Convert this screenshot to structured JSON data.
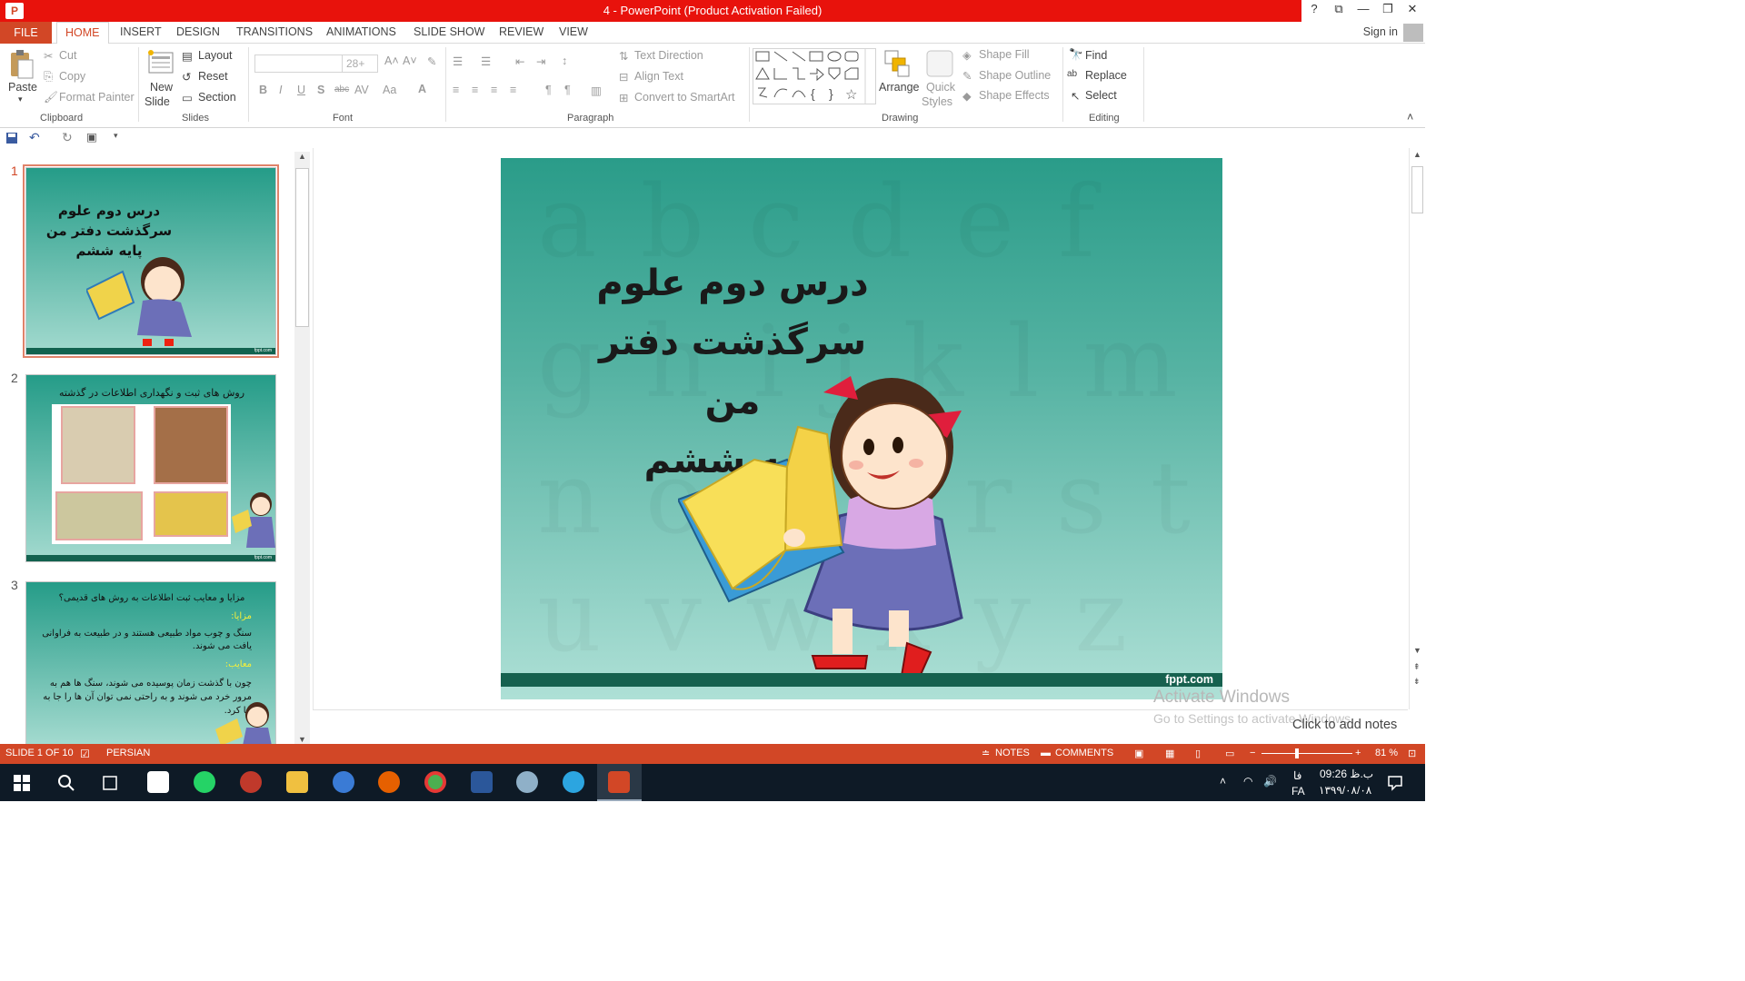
{
  "window": {
    "title": "4 -  PowerPoint (Product Activation Failed)",
    "app_icon": "P",
    "controls": [
      "?",
      "⧉",
      "—",
      "❐",
      "✕"
    ]
  },
  "tabs": {
    "file": "FILE",
    "items": [
      "HOME",
      "INSERT",
      "DESIGN",
      "TRANSITIONS",
      "ANIMATIONS",
      "SLIDE SHOW",
      "REVIEW",
      "VIEW"
    ],
    "sign_in": "Sign in"
  },
  "ribbon": {
    "clipboard": {
      "paste": "Paste",
      "cut": "Cut",
      "copy": "Copy",
      "format_painter": "Format Painter",
      "label": "Clipboard"
    },
    "slides": {
      "new_slide_1": "New",
      "new_slide_2": "Slide",
      "layout": "Layout",
      "reset": "Reset",
      "section": "Section",
      "label": "Slides"
    },
    "font": {
      "size": "28+",
      "label": "Font"
    },
    "paragraph": {
      "text_direction": "Text Direction",
      "align_text": "Align Text",
      "convert_smartart": "Convert to SmartArt",
      "label": "Paragraph"
    },
    "drawing": {
      "arrange": "Arrange",
      "quick_styles_1": "Quick",
      "quick_styles_2": "Styles",
      "shape_fill": "Shape Fill",
      "shape_outline": "Shape Outline",
      "shape_effects": "Shape Effects",
      "label": "Drawing"
    },
    "editing": {
      "find": "Find",
      "replace": "Replace",
      "select": "Select",
      "label": "Editing"
    }
  },
  "thumbnails": [
    {
      "num": "1",
      "title": "درس دوم علوم\nسرگذشت دفتر من\nپایه ششم",
      "brand": "fppt.com"
    },
    {
      "num": "2",
      "title": "روش های ثبت و نگهداری اطلاعات در گذشته",
      "brand": "fppt.com"
    },
    {
      "num": "3",
      "title": "مزایا و معایب ثبت اطلاعات به روش های قدیمی؟",
      "pros_label": "مزایا:",
      "pros": "سنگ و چوب مواد طبیعی هستند و در طبیعت به فراوانی یافت می شوند.",
      "cons_label": "معایب:",
      "cons": "چون با گذشت زمان پوسیده می شوند، سنگ ها هم به مرور خرد می شوند و به راحتی نمی توان آن ها را جا به جا کرد."
    }
  ],
  "slide": {
    "line1": "درس دوم علوم",
    "line2": "سرگذشت دفتر من",
    "line3": "پایه ششم",
    "brand": "fppt.com"
  },
  "notes": {
    "placeholder": "Click to add notes",
    "activate_title": "Activate Windows",
    "activate_sub": "Go to Settings to activate Windows."
  },
  "status": {
    "slide_info": "SLIDE 1 OF 10",
    "language": "PERSIAN",
    "notes": "NOTES",
    "comments": "COMMENTS",
    "zoom": "81 %"
  },
  "taskbar": {
    "lang": "FA",
    "lang2": "فا",
    "time": "09:26 ب.ظ",
    "date": "۱۳۹۹/۰۸/۰۸"
  },
  "colors": {
    "accent": "#d24726",
    "titlebar": "#e8120c",
    "slide_top": "#2a9c89",
    "slide_bottom": "#aee0d6"
  }
}
